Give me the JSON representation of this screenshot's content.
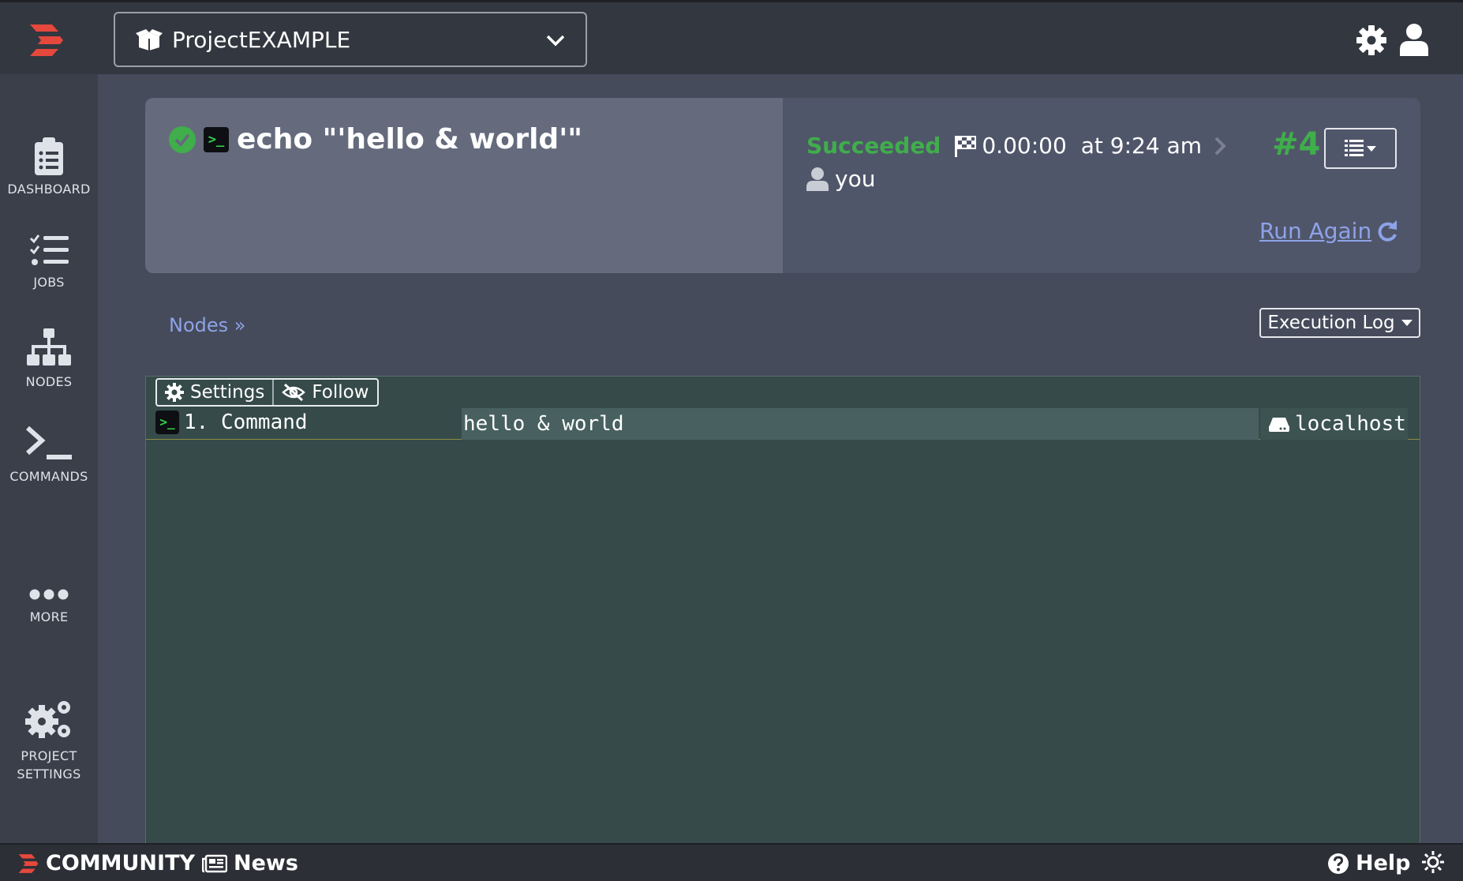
{
  "app": {
    "project_name": "ProjectEXAMPLE"
  },
  "sidebar": {
    "items": [
      {
        "label": "DASHBOARD",
        "icon": "clipboard-icon"
      },
      {
        "label": "JOBS",
        "icon": "checklist-icon"
      },
      {
        "label": "NODES",
        "icon": "sitemap-icon"
      },
      {
        "label": "COMMANDS",
        "icon": "terminal-icon"
      },
      {
        "label": "MORE",
        "icon": "more-icon"
      },
      {
        "label_line1": "PROJECT",
        "label_line2": "SETTINGS",
        "icon": "gears-icon"
      }
    ]
  },
  "execution": {
    "title": "echo \"'hello & world'\"",
    "terminal_badge": ">_",
    "status": "Succeeded",
    "duration": "0.00:00",
    "time": "at 9:24 am",
    "user": "you",
    "number": "#4",
    "run_again_label": "Run Again"
  },
  "nodes_link": "Nodes »",
  "view_menu_label": "Execution Log",
  "log": {
    "settings_label": "Settings",
    "follow_label": "Follow",
    "step_label": "1. Command",
    "output": "hello & world",
    "node": "localhost"
  },
  "footer": {
    "community_label": "COMMUNITY",
    "news_label": "News",
    "help_label": "Help"
  },
  "colors": {
    "success": "#3fae4b",
    "link": "#8ea2e8",
    "brand": "#e5483d"
  }
}
